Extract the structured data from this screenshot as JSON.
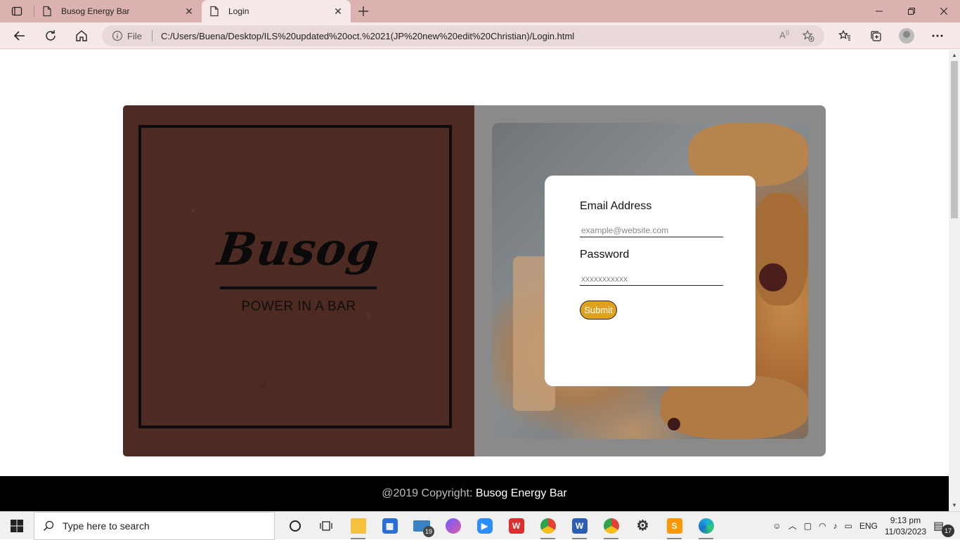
{
  "browser": {
    "tabs": [
      {
        "title": "Busog Energy Bar",
        "active": false
      },
      {
        "title": "Login",
        "active": true
      }
    ],
    "address": {
      "scheme_label": "File",
      "url": "C:/Users/Buena/Desktop/ILS%20updated%20oct.%2021(JP%20new%20edit%20Christian)/Login.html"
    }
  },
  "brand": {
    "name": "Busog",
    "tagline": "POWER IN A BAR"
  },
  "login": {
    "email_label": "Email Address",
    "email_placeholder": "example@website.com",
    "password_label": "Password",
    "password_placeholder": "xxxxxxxxxxx",
    "submit_label": "Submit"
  },
  "footer": {
    "prefix": "@2019 Copyright:",
    "brand": "Busog Energy Bar"
  },
  "taskbar": {
    "search_placeholder": "Type here to search",
    "mail_badge": "19",
    "language": "ENG",
    "time": "9:13 pm",
    "date": "11/03/2023",
    "notification_count": "17"
  },
  "colors": {
    "tabbar": "#dcb2b0",
    "brand_panel": "#4d2a22",
    "form_panel": "#8a8a8a",
    "submit_button": "#e0a020",
    "footer": "#000000"
  }
}
